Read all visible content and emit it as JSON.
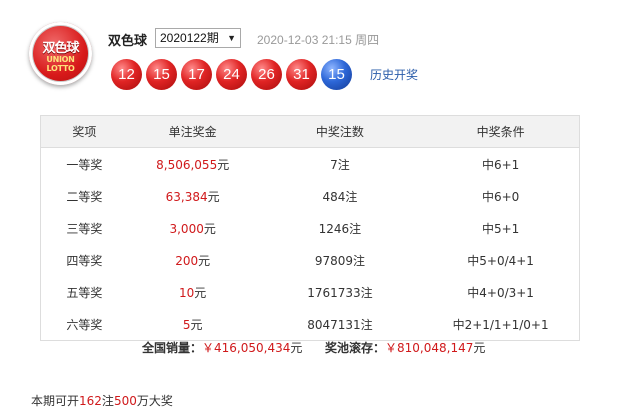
{
  "logo": {
    "line1": "双色球",
    "line2": "UNION",
    "line3": "LOTTO"
  },
  "header": {
    "lottery_name": "双色球",
    "issue_selected": "2020122期",
    "draw_time": "2020-12-03 21:15 周四",
    "history_link": "历史开奖"
  },
  "balls": {
    "red": [
      "12",
      "15",
      "17",
      "24",
      "26",
      "31"
    ],
    "blue": "15"
  },
  "table": {
    "headers": [
      "奖项",
      "单注奖金",
      "中奖注数",
      "中奖条件"
    ],
    "rows": [
      {
        "level": "一等奖",
        "amount": "8,506,055",
        "unit": "元",
        "count": "7注",
        "condition": "中6+1"
      },
      {
        "level": "二等奖",
        "amount": "63,384",
        "unit": "元",
        "count": "484注",
        "condition": "中6+0"
      },
      {
        "level": "三等奖",
        "amount": "3,000",
        "unit": "元",
        "count": "1246注",
        "condition": "中5+1"
      },
      {
        "level": "四等奖",
        "amount": "200",
        "unit": "元",
        "count": "97809注",
        "condition": "中5+0/4+1"
      },
      {
        "level": "五等奖",
        "amount": "10",
        "unit": "元",
        "count": "1761733注",
        "condition": "中4+0/3+1"
      },
      {
        "level": "六等奖",
        "amount": "5",
        "unit": "元",
        "count": "8047131注",
        "condition": "中2+1/1+1/0+1"
      }
    ]
  },
  "totals": {
    "sales_label": "全国销量：",
    "sales_value": "￥416,050,434",
    "sales_unit": "元",
    "pool_label": "奖池滚存：",
    "pool_value": "￥810,048,147",
    "pool_unit": "元"
  },
  "footnote": {
    "prefix": "本期可开",
    "count": "162",
    "mid": "注",
    "amount": "500",
    "suffix": "万大奖"
  },
  "colors": {
    "accent_red": "#d0191b",
    "link_blue": "#2a5caa",
    "header_bg": "#f2f2f2"
  }
}
